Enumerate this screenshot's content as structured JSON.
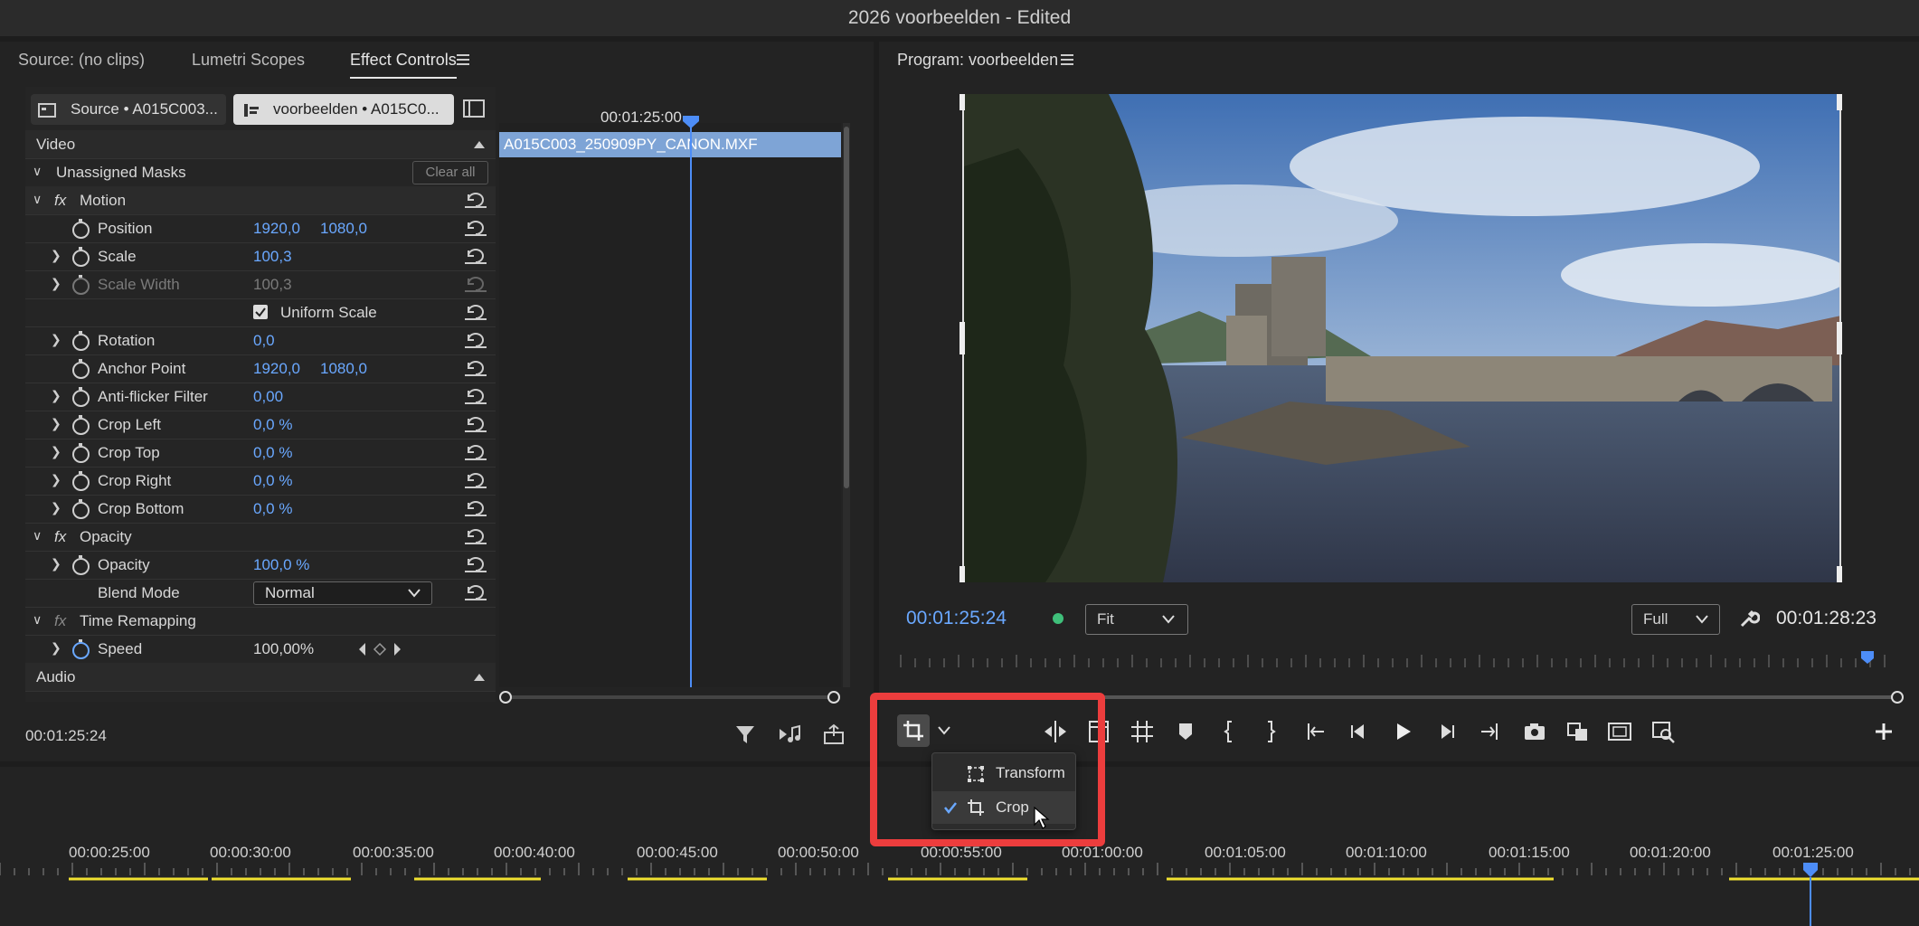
{
  "window": {
    "title": "2026 voorbeelden - Edited"
  },
  "left_tabs": {
    "source": "Source: (no clips)",
    "lumetri": "Lumetri Scopes",
    "effect_controls": "Effect Controls"
  },
  "ec": {
    "source_pill": "Source • A015C003...",
    "sequence_pill": "voorbeelden • A015C0...",
    "timeline_timecode": "00:01:25:00",
    "clip_name": "A015C003_250909PY_CANON.MXF",
    "video_header": "Video",
    "masks_label": "Unassigned Masks",
    "clear_all": "Clear all",
    "motion": "Motion",
    "position": {
      "label": "Position",
      "x": "1920,0",
      "y": "1080,0"
    },
    "scale": {
      "label": "Scale",
      "value": "100,3"
    },
    "scale_width": {
      "label": "Scale Width",
      "value": "100,3"
    },
    "uniform_scale": "Uniform Scale",
    "rotation": {
      "label": "Rotation",
      "value": "0,0"
    },
    "anchor": {
      "label": "Anchor Point",
      "x": "1920,0",
      "y": "1080,0"
    },
    "antiflicker": {
      "label": "Anti-flicker Filter",
      "value": "0,00"
    },
    "crop_left": {
      "label": "Crop Left",
      "value": "0,0 %"
    },
    "crop_top": {
      "label": "Crop Top",
      "value": "0,0 %"
    },
    "crop_right": {
      "label": "Crop Right",
      "value": "0,0 %"
    },
    "crop_bottom": {
      "label": "Crop Bottom",
      "value": "0,0 %"
    },
    "opacity_section": "Opacity",
    "opacity": {
      "label": "Opacity",
      "value": "100,0 %"
    },
    "blend": {
      "label": "Blend Mode",
      "value": "Normal"
    },
    "time_remap": "Time Remapping",
    "speed": {
      "label": "Speed",
      "value": "100,00%"
    },
    "audio_header": "Audio",
    "current_time": "00:01:25:24"
  },
  "program": {
    "title": "Program: voorbeelden",
    "current_time": "00:01:25:24",
    "fit": "Fit",
    "quality": "Full",
    "duration": "00:01:28:23"
  },
  "menu": {
    "transform": "Transform",
    "crop": "Crop"
  },
  "timeline": {
    "timecodes": [
      "00:00:25:00",
      "00:00:30:00",
      "00:00:35:00",
      "00:00:40:00",
      "00:00:45:00",
      "00:00:50:00",
      "00:00:55:00",
      "00:01:00:00",
      "00:01:05:00",
      "00:01:10:00",
      "00:01:15:00",
      "00:01:20:00",
      "00:01:25:00"
    ]
  },
  "colors": {
    "accent": "#6aa8ff",
    "highlight": "#ec3d3d",
    "clip": "#7ea4d6",
    "marker": "#f0e030"
  }
}
